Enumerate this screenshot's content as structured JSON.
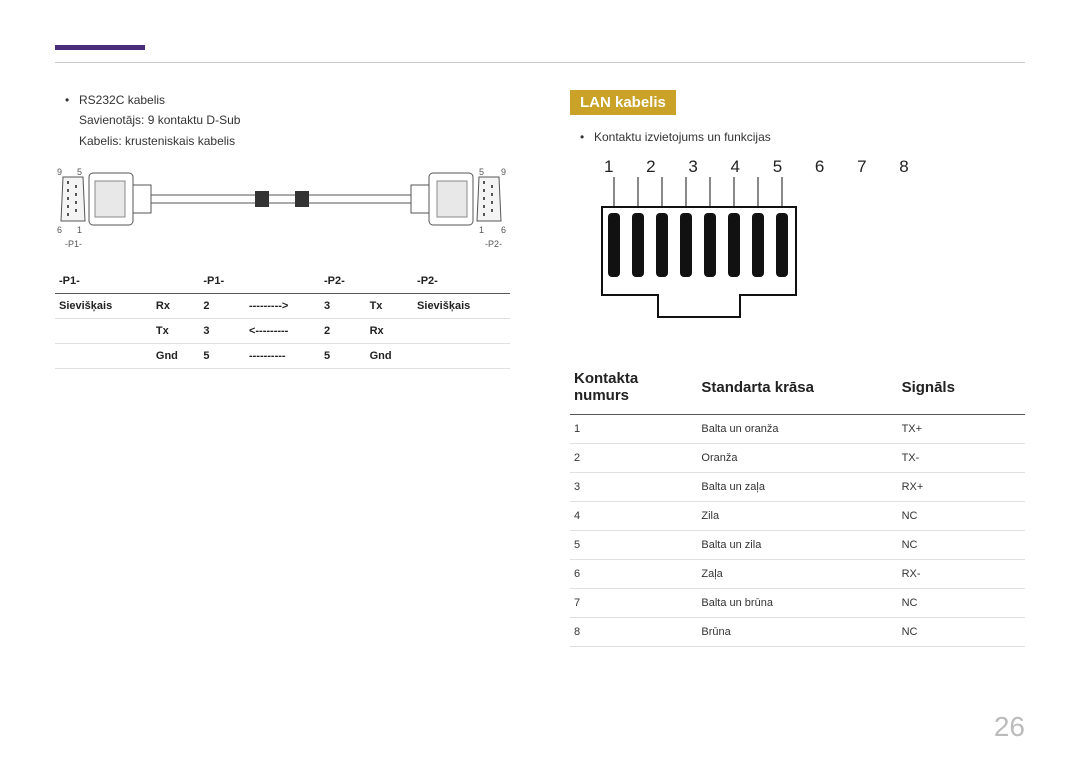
{
  "page_number": "26",
  "left": {
    "bullet_line1": "RS232C kabelis",
    "bullet_line2": "Savienotājs: 9 kontaktu D-Sub",
    "bullet_line3": "Kabelis: krusteniskais kabelis",
    "diagram_labels": {
      "tl": "9",
      "tl2": "5",
      "bl": "6",
      "bl2": "1",
      "p1": "-P1-",
      "tr": "5",
      "tr2": "9",
      "br": "1",
      "br2": "6",
      "p2": "-P2-"
    },
    "table": {
      "headers": [
        "-P1-",
        "",
        "-P1-",
        "",
        "-P2-",
        "",
        "-P2-"
      ],
      "rows": [
        [
          "Sievišķais",
          "Rx",
          "2",
          "--------->",
          "3",
          "Tx",
          "Sievišķais"
        ],
        [
          "",
          "Tx",
          "3",
          "<---------",
          "2",
          "Rx",
          ""
        ],
        [
          "",
          "Gnd",
          "5",
          "----------",
          "5",
          "Gnd",
          ""
        ]
      ]
    }
  },
  "right": {
    "section_title": "LAN kabelis",
    "bullet": "Kontaktu izvietojums un funkcijas",
    "pin_numbers": "1 2 3 4 5 6 7 8",
    "table": {
      "headers": [
        "Kontakta numurs",
        "Standarta krāsa",
        "Signāls"
      ],
      "rows": [
        [
          "1",
          "Balta un oranža",
          "TX+"
        ],
        [
          "2",
          "Oranža",
          "TX-"
        ],
        [
          "3",
          "Balta un zaļa",
          "RX+"
        ],
        [
          "4",
          "Zila",
          "NC"
        ],
        [
          "5",
          "Balta un zila",
          "NC"
        ],
        [
          "6",
          "Zaļa",
          "RX-"
        ],
        [
          "7",
          "Balta un brūna",
          "NC"
        ],
        [
          "8",
          "Brūna",
          "NC"
        ]
      ]
    }
  }
}
